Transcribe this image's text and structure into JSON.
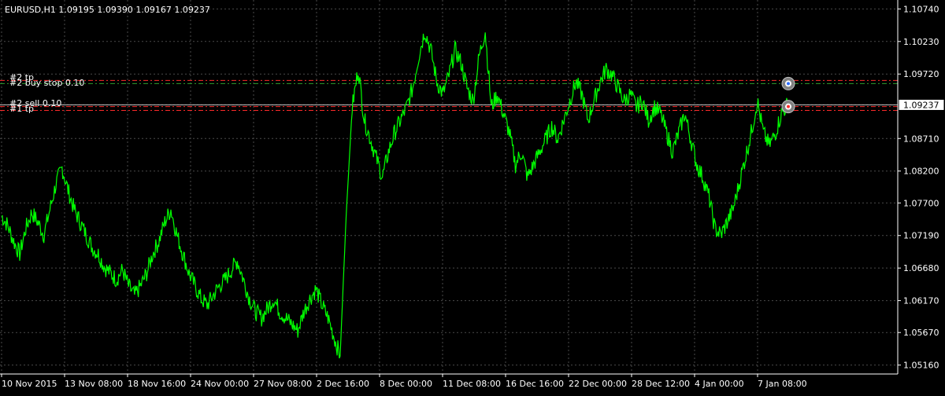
{
  "chart": {
    "symbol_info": "EURUSD,H1  1.09195 1.09390 1.09167 1.09237",
    "current_price": "1.09237"
  },
  "colors": {
    "background": "#000000",
    "grid": "#4a4a4a",
    "price_line": "#00ff00",
    "axis_text": "#ffffff",
    "order_line_red": "#ff2a2a",
    "order_line_green": "#2e9f2e",
    "bid_line": "#c0c0c0"
  },
  "orders": [
    {
      "label": "#2 tp",
      "price": 1.0962,
      "color": "#ff2a2a"
    },
    {
      "label": "#2 buy stop 0.10",
      "price": 1.0957,
      "color": "#2e9f2e"
    },
    {
      "label": "#2 sell 0.10",
      "price": 1.0921,
      "color": "#ff2a2a"
    },
    {
      "label": "#1 tp",
      "price": 1.0915,
      "color": "#ff2a2a"
    }
  ],
  "chart_data": {
    "type": "line",
    "ylim": [
      1.0502,
      1.1088
    ],
    "y_ticks": [
      "1.10740",
      "1.10230",
      "1.09720",
      "1.09237",
      "1.08710",
      "1.08200",
      "1.07700",
      "1.07190",
      "1.06680",
      "1.06170",
      "1.05670",
      "1.05160"
    ],
    "y_tick_values": [
      1.1074,
      1.1023,
      1.0972,
      1.0924,
      1.0871,
      1.082,
      1.077,
      1.0719,
      1.0668,
      1.0617,
      1.0567,
      1.0516
    ],
    "x_ticks": [
      "10 Nov 2015",
      "13 Nov 08:00",
      "18 Nov 16:00",
      "24 Nov 00:00",
      "27 Nov 08:00",
      "2 Dec 16:00",
      "8 Dec 00:00",
      "11 Dec 08:00",
      "16 Dec 16:00",
      "22 Dec 00:00",
      "28 Dec 12:00",
      "4 Jan 00:00",
      "7 Jan 08:00"
    ],
    "series": [
      {
        "values": [
          1.075,
          1.0735,
          1.071,
          1.069,
          1.073,
          1.0755,
          1.074,
          1.072,
          1.076,
          1.08,
          1.0825,
          1.079,
          1.076,
          1.074,
          1.072,
          1.07,
          1.069,
          1.067,
          1.066,
          1.065,
          1.0665,
          1.064,
          1.0625,
          1.064,
          1.066,
          1.069,
          1.071,
          1.074,
          1.076,
          1.072,
          1.069,
          1.066,
          1.064,
          1.062,
          1.061,
          1.0625,
          1.064,
          1.065,
          1.0665,
          1.068,
          1.065,
          1.062,
          1.06,
          1.059,
          1.0605,
          1.062,
          1.06,
          1.059,
          1.058,
          1.057,
          1.06,
          1.062,
          1.0635,
          1.061,
          1.059,
          1.056,
          1.053,
          1.075,
          1.092,
          1.098,
          1.09,
          1.087,
          1.084,
          1.081,
          1.085,
          1.088,
          1.09,
          1.092,
          1.095,
          1.1,
          1.104,
          1.101,
          1.096,
          1.094,
          1.097,
          1.101,
          1.099,
          1.095,
          1.093,
          1.1,
          1.104,
          1.092,
          1.094,
          1.091,
          1.088,
          1.083,
          1.085,
          1.081,
          1.083,
          1.085,
          1.087,
          1.089,
          1.087,
          1.09,
          1.093,
          1.096,
          1.094,
          1.09,
          1.093,
          1.096,
          1.098,
          1.097,
          1.095,
          1.093,
          1.094,
          1.092,
          1.093,
          1.09,
          1.092,
          1.091,
          1.088,
          1.085,
          1.088,
          1.091,
          1.087,
          1.083,
          1.081,
          1.078,
          1.073,
          1.072,
          1.074,
          1.076,
          1.08,
          1.084,
          1.088,
          1.093,
          1.088,
          1.086,
          1.088,
          1.091,
          1.0924
        ]
      }
    ]
  }
}
